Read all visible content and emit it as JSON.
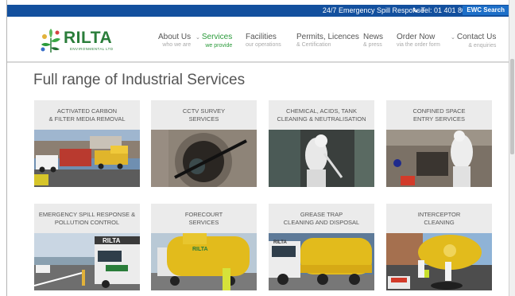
{
  "topbar": {
    "emergency": "24/7 Emergency Spill Response",
    "tel": "Tel: 01 401 8000",
    "ewc": "EWC Search"
  },
  "logo": {
    "brand": "RILTA",
    "sub": "ENVIRONMENTAL LTD"
  },
  "nav": [
    {
      "main": "About Us",
      "sub": "who we are",
      "dropdown": true,
      "active": false
    },
    {
      "main": "Services",
      "sub": "we provide",
      "dropdown": true,
      "active": true
    },
    {
      "main": "Facilities",
      "sub": "our operations",
      "dropdown": false,
      "active": false
    },
    {
      "main": "Permits, Licences",
      "sub": "& Certification",
      "dropdown": false,
      "active": false
    },
    {
      "main": "News",
      "sub": "& press",
      "dropdown": false,
      "active": false
    },
    {
      "main": "Order Now",
      "sub": "via the order form",
      "dropdown": false,
      "active": false
    },
    {
      "main": "Contact Us",
      "sub": "& enquiries",
      "dropdown": true,
      "active": false
    }
  ],
  "page_title": "Full range of Industrial Services",
  "services": [
    {
      "line1": "ACTIVATED CARBON",
      "line2": "& FILTER MEDIA REMOVAL"
    },
    {
      "line1": "CCTV SURVEY",
      "line2": "SERVICES"
    },
    {
      "line1": "CHEMICAL, ACIDS, TANK",
      "line2": "CLEANING & NEUTRALISATION"
    },
    {
      "line1": "CONFINED SPACE",
      "line2": "ENTRY SERVICES"
    },
    {
      "line1": "EMERGENCY SPILL RESPONSE &",
      "line2": "POLLUTION CONTROL"
    },
    {
      "line1": "FORECOURT",
      "line2": "SERVICES"
    },
    {
      "line1": "GREASE TRAP",
      "line2": "CLEANING AND DISPOSAL"
    },
    {
      "line1": "INTERCEPTOR",
      "line2": "CLEANING"
    }
  ],
  "truck_labels": {
    "rilta": "RILTA"
  },
  "colors": {
    "topbar": "#13509e",
    "brand_green": "#2a7d3a",
    "active_nav": "#2a9a3a",
    "card_caption_bg": "#ebebeb"
  }
}
